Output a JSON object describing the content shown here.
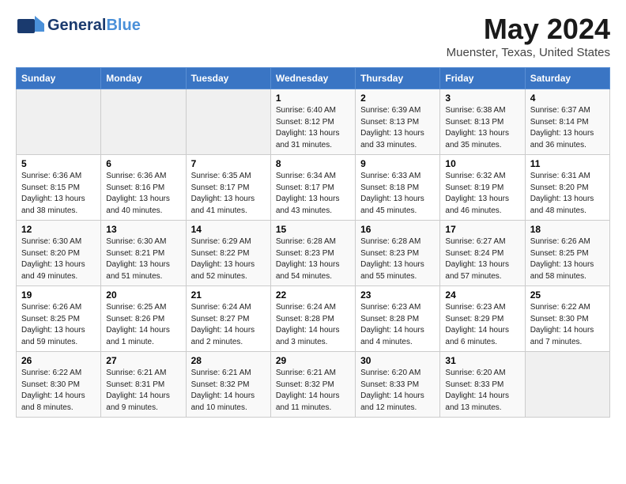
{
  "header": {
    "logo_general": "General",
    "logo_blue": "Blue",
    "title": "May 2024",
    "subtitle": "Muenster, Texas, United States"
  },
  "days_of_week": [
    "Sunday",
    "Monday",
    "Tuesday",
    "Wednesday",
    "Thursday",
    "Friday",
    "Saturday"
  ],
  "weeks": [
    [
      {
        "day": "",
        "empty": true
      },
      {
        "day": "",
        "empty": true
      },
      {
        "day": "",
        "empty": true
      },
      {
        "day": "1",
        "sunrise": "6:40 AM",
        "sunset": "8:12 PM",
        "daylight": "13 hours and 31 minutes."
      },
      {
        "day": "2",
        "sunrise": "6:39 AM",
        "sunset": "8:13 PM",
        "daylight": "13 hours and 33 minutes."
      },
      {
        "day": "3",
        "sunrise": "6:38 AM",
        "sunset": "8:13 PM",
        "daylight": "13 hours and 35 minutes."
      },
      {
        "day": "4",
        "sunrise": "6:37 AM",
        "sunset": "8:14 PM",
        "daylight": "13 hours and 36 minutes."
      }
    ],
    [
      {
        "day": "5",
        "sunrise": "6:36 AM",
        "sunset": "8:15 PM",
        "daylight": "13 hours and 38 minutes."
      },
      {
        "day": "6",
        "sunrise": "6:36 AM",
        "sunset": "8:16 PM",
        "daylight": "13 hours and 40 minutes."
      },
      {
        "day": "7",
        "sunrise": "6:35 AM",
        "sunset": "8:17 PM",
        "daylight": "13 hours and 41 minutes."
      },
      {
        "day": "8",
        "sunrise": "6:34 AM",
        "sunset": "8:17 PM",
        "daylight": "13 hours and 43 minutes."
      },
      {
        "day": "9",
        "sunrise": "6:33 AM",
        "sunset": "8:18 PM",
        "daylight": "13 hours and 45 minutes."
      },
      {
        "day": "10",
        "sunrise": "6:32 AM",
        "sunset": "8:19 PM",
        "daylight": "13 hours and 46 minutes."
      },
      {
        "day": "11",
        "sunrise": "6:31 AM",
        "sunset": "8:20 PM",
        "daylight": "13 hours and 48 minutes."
      }
    ],
    [
      {
        "day": "12",
        "sunrise": "6:30 AM",
        "sunset": "8:20 PM",
        "daylight": "13 hours and 49 minutes."
      },
      {
        "day": "13",
        "sunrise": "6:30 AM",
        "sunset": "8:21 PM",
        "daylight": "13 hours and 51 minutes."
      },
      {
        "day": "14",
        "sunrise": "6:29 AM",
        "sunset": "8:22 PM",
        "daylight": "13 hours and 52 minutes."
      },
      {
        "day": "15",
        "sunrise": "6:28 AM",
        "sunset": "8:23 PM",
        "daylight": "13 hours and 54 minutes."
      },
      {
        "day": "16",
        "sunrise": "6:28 AM",
        "sunset": "8:23 PM",
        "daylight": "13 hours and 55 minutes."
      },
      {
        "day": "17",
        "sunrise": "6:27 AM",
        "sunset": "8:24 PM",
        "daylight": "13 hours and 57 minutes."
      },
      {
        "day": "18",
        "sunrise": "6:26 AM",
        "sunset": "8:25 PM",
        "daylight": "13 hours and 58 minutes."
      }
    ],
    [
      {
        "day": "19",
        "sunrise": "6:26 AM",
        "sunset": "8:25 PM",
        "daylight": "13 hours and 59 minutes."
      },
      {
        "day": "20",
        "sunrise": "6:25 AM",
        "sunset": "8:26 PM",
        "daylight": "14 hours and 1 minute."
      },
      {
        "day": "21",
        "sunrise": "6:24 AM",
        "sunset": "8:27 PM",
        "daylight": "14 hours and 2 minutes."
      },
      {
        "day": "22",
        "sunrise": "6:24 AM",
        "sunset": "8:28 PM",
        "daylight": "14 hours and 3 minutes."
      },
      {
        "day": "23",
        "sunrise": "6:23 AM",
        "sunset": "8:28 PM",
        "daylight": "14 hours and 4 minutes."
      },
      {
        "day": "24",
        "sunrise": "6:23 AM",
        "sunset": "8:29 PM",
        "daylight": "14 hours and 6 minutes."
      },
      {
        "day": "25",
        "sunrise": "6:22 AM",
        "sunset": "8:30 PM",
        "daylight": "14 hours and 7 minutes."
      }
    ],
    [
      {
        "day": "26",
        "sunrise": "6:22 AM",
        "sunset": "8:30 PM",
        "daylight": "14 hours and 8 minutes."
      },
      {
        "day": "27",
        "sunrise": "6:21 AM",
        "sunset": "8:31 PM",
        "daylight": "14 hours and 9 minutes."
      },
      {
        "day": "28",
        "sunrise": "6:21 AM",
        "sunset": "8:32 PM",
        "daylight": "14 hours and 10 minutes."
      },
      {
        "day": "29",
        "sunrise": "6:21 AM",
        "sunset": "8:32 PM",
        "daylight": "14 hours and 11 minutes."
      },
      {
        "day": "30",
        "sunrise": "6:20 AM",
        "sunset": "8:33 PM",
        "daylight": "14 hours and 12 minutes."
      },
      {
        "day": "31",
        "sunrise": "6:20 AM",
        "sunset": "8:33 PM",
        "daylight": "14 hours and 13 minutes."
      },
      {
        "day": "",
        "empty": true
      }
    ]
  ]
}
